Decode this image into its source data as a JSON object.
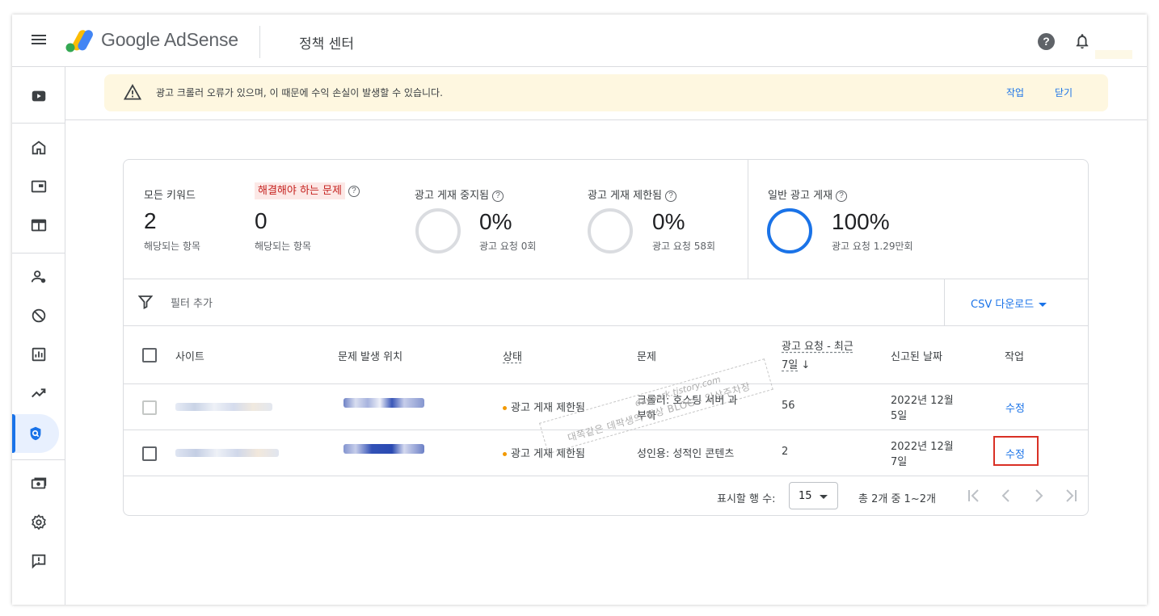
{
  "header": {
    "brand": "Google AdSense",
    "page_title": "정책 센터",
    "help_icon_glyph": "?"
  },
  "colors": {
    "accent": "#1a73e8",
    "warning_bg": "#fef7e0",
    "status_dot": "#f29900",
    "issue_red": "#c5221f",
    "highlight_box": "#d93025"
  },
  "banner": {
    "message": "광고 크롤러 오류가 있으며, 이 때문에 수익 손실이 발생할 수 있습니다.",
    "action_label": "작업",
    "dismiss_label": "닫기"
  },
  "summary": {
    "all_keywords": {
      "label": "모든 키워드",
      "value": "2",
      "sub": "해당되는 항목"
    },
    "issues": {
      "label": "해결해야 하는 문제",
      "value": "0",
      "sub": "해당되는 항목"
    },
    "disabled": {
      "label": "광고 게재 중지됨",
      "value": "0%",
      "sub": "광고 요청 0회",
      "fraction": 0
    },
    "restricted": {
      "label": "광고 게재 제한됨",
      "value": "0%",
      "sub": "광고 요청 58회",
      "fraction": 0
    },
    "normal": {
      "label": "일반 광고 게재",
      "value": "100%",
      "sub": "광고 요청 1.29만회",
      "fraction": 1
    }
  },
  "toolbar": {
    "filter_label": "필터 추가",
    "csv_label": "CSV 다운로드"
  },
  "table": {
    "headers": {
      "site": "사이트",
      "location": "문제 발생 위치",
      "status": "상태",
      "issue": "문제",
      "requests_line1": "광고 요청 - 최근",
      "requests_line2": "7일",
      "sort_arrow": "↓",
      "reported": "신고된 날짜",
      "action": "작업"
    },
    "rows": [
      {
        "status": "광고 게재 제한됨",
        "issue_line1": "크롤러: 호스팅 서버 과",
        "issue_line2": "부하",
        "requests": "56",
        "date_line1": "2022년 12월",
        "date_line2": "5일",
        "action": "수정"
      },
      {
        "status": "광고 게재 제한됨",
        "issue_line1": "성인용: 성적인 콘텐츠",
        "issue_line2": "",
        "requests": "2",
        "date_line1": "2022년 12월",
        "date_line2": "7일",
        "action": "수정"
      }
    ]
  },
  "pagination": {
    "rows_label": "표시할 행 수:",
    "rows_value": "15",
    "range_label": "총 2개 중 1~2개"
  },
  "watermark": {
    "line1": "daypark.tistory.com",
    "line2": "대쪽같은 데팍생의 일상 BLOG - 일상주차장"
  },
  "icons": {
    "menu": "menu-icon",
    "help": "help-circle-icon",
    "notifications": "bell-icon",
    "warning": "warning-triangle-icon",
    "filter": "filter-funnel-icon",
    "sidebar": [
      "youtube-icon",
      "home-icon",
      "ad-unit-icon",
      "sites-icon",
      "account-user-icon",
      "block-icon",
      "reports-icon",
      "optimization-icon",
      "policy-shield-icon",
      "payments-icon",
      "settings-gear-icon",
      "feedback-icon"
    ]
  }
}
